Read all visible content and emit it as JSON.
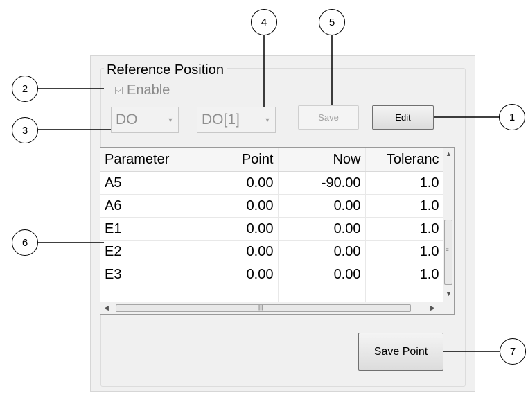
{
  "group": {
    "title": "Reference Position",
    "enable_label": "Enable"
  },
  "signal_type": {
    "value": "DO"
  },
  "signal_index": {
    "value": "DO[1]"
  },
  "buttons": {
    "save": "Save",
    "edit": "Edit",
    "save_point": "Save Point"
  },
  "table": {
    "columns": [
      "Parameter",
      "Point",
      "Now",
      "Toleranc"
    ],
    "rows": [
      [
        "A5",
        "0.00",
        "-90.00",
        "1.0"
      ],
      [
        "A6",
        "0.00",
        "0.00",
        "1.0"
      ],
      [
        "E1",
        "0.00",
        "0.00",
        "1.0"
      ],
      [
        "E2",
        "0.00",
        "0.00",
        "1.0"
      ],
      [
        "E3",
        "0.00",
        "0.00",
        "1.0"
      ]
    ]
  },
  "callouts": [
    "1",
    "2",
    "3",
    "4",
    "5",
    "6",
    "7"
  ],
  "icons": {
    "combo_arrow": "chevron-down-icon",
    "scroll_up": "scroll-up-arrow-icon",
    "scroll_down": "scroll-down-arrow-icon",
    "scroll_left": "scroll-left-arrow-icon",
    "scroll_right": "scroll-right-arrow-icon"
  }
}
